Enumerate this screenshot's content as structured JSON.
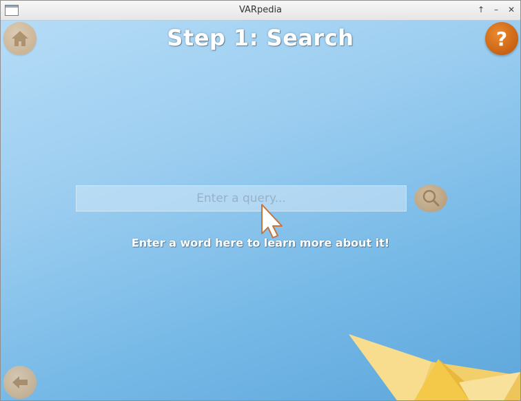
{
  "window": {
    "title": "VARpedia",
    "controls": {
      "maximize": "↑",
      "minimize": "–",
      "close": "✕"
    }
  },
  "header": {
    "title": "Step 1: Search",
    "home_icon": "home-icon",
    "help_icon": "question-mark-icon",
    "help_glyph": "?"
  },
  "search": {
    "placeholder": "Enter a query...",
    "value": "",
    "button_icon": "search-icon"
  },
  "hint": {
    "text": "Enter a word here to learn more about it!"
  },
  "footer": {
    "back_icon": "arrow-left-icon"
  },
  "colors": {
    "background_light": "#b5dcf7",
    "background_dark": "#5ea6db",
    "help_button": "#d46a12",
    "muted_button": "#d4b38a",
    "boat": "#f5d77a"
  }
}
